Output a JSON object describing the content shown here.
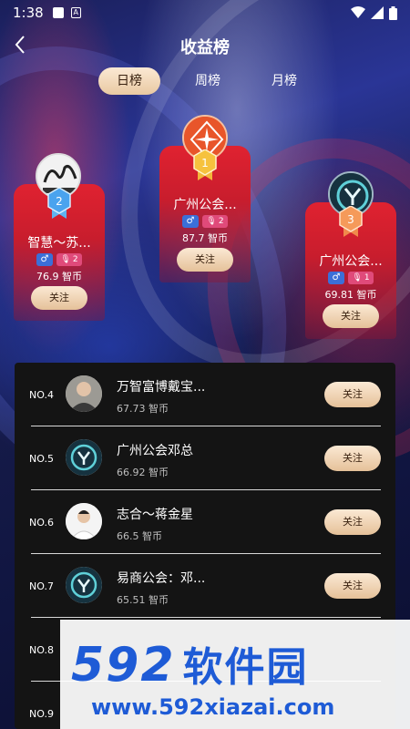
{
  "status_bar": {
    "time": "1:38",
    "app_icon_letter": "A"
  },
  "header": {
    "title": "收益榜"
  },
  "tabs": [
    {
      "label": "日榜",
      "active": true
    },
    {
      "label": "周榜",
      "active": false
    },
    {
      "label": "月榜",
      "active": false
    }
  ],
  "podium": {
    "first": {
      "rank": "1",
      "name": "广州公会...",
      "male_symbol": "♂",
      "level": "2",
      "value": "87.7 智币",
      "follow_label": "关注"
    },
    "second": {
      "rank": "2",
      "name": "智慧～苏...",
      "male_symbol": "♂",
      "level": "2",
      "value": "76.9 智币",
      "follow_label": "关注"
    },
    "third": {
      "rank": "3",
      "name": "广州公会...",
      "male_symbol": "♂",
      "level": "1",
      "value": "69.81 智币",
      "follow_label": "关注"
    }
  },
  "list": [
    {
      "rank": "NO.4",
      "name": "万智富博戴宝...",
      "value": "67.73 智币",
      "follow_label": "关注",
      "avatar": "photo"
    },
    {
      "rank": "NO.5",
      "name": "广州公会邓总",
      "value": "66.92 智币",
      "follow_label": "关注",
      "avatar": "logo"
    },
    {
      "rank": "NO.6",
      "name": "志合～蒋金星",
      "value": "66.5 智币",
      "follow_label": "关注",
      "avatar": "photo-light"
    },
    {
      "rank": "NO.7",
      "name": "易商公会：邓...",
      "value": "65.51 智币",
      "follow_label": "关注",
      "avatar": "logo"
    },
    {
      "rank": "NO.8",
      "name": "",
      "value": "",
      "follow_label": "",
      "avatar": ""
    },
    {
      "rank": "NO.9",
      "name": "",
      "value": "",
      "follow_label": "",
      "avatar": ""
    }
  ],
  "watermark": {
    "main": "592",
    "cn": "软件园",
    "url": "www.592xiazai.com"
  },
  "colors": {
    "accent_gold": "#e9c9a2",
    "card_red": "#e02230",
    "list_bg": "#141414",
    "brand_blue": "#1e5bd6"
  }
}
